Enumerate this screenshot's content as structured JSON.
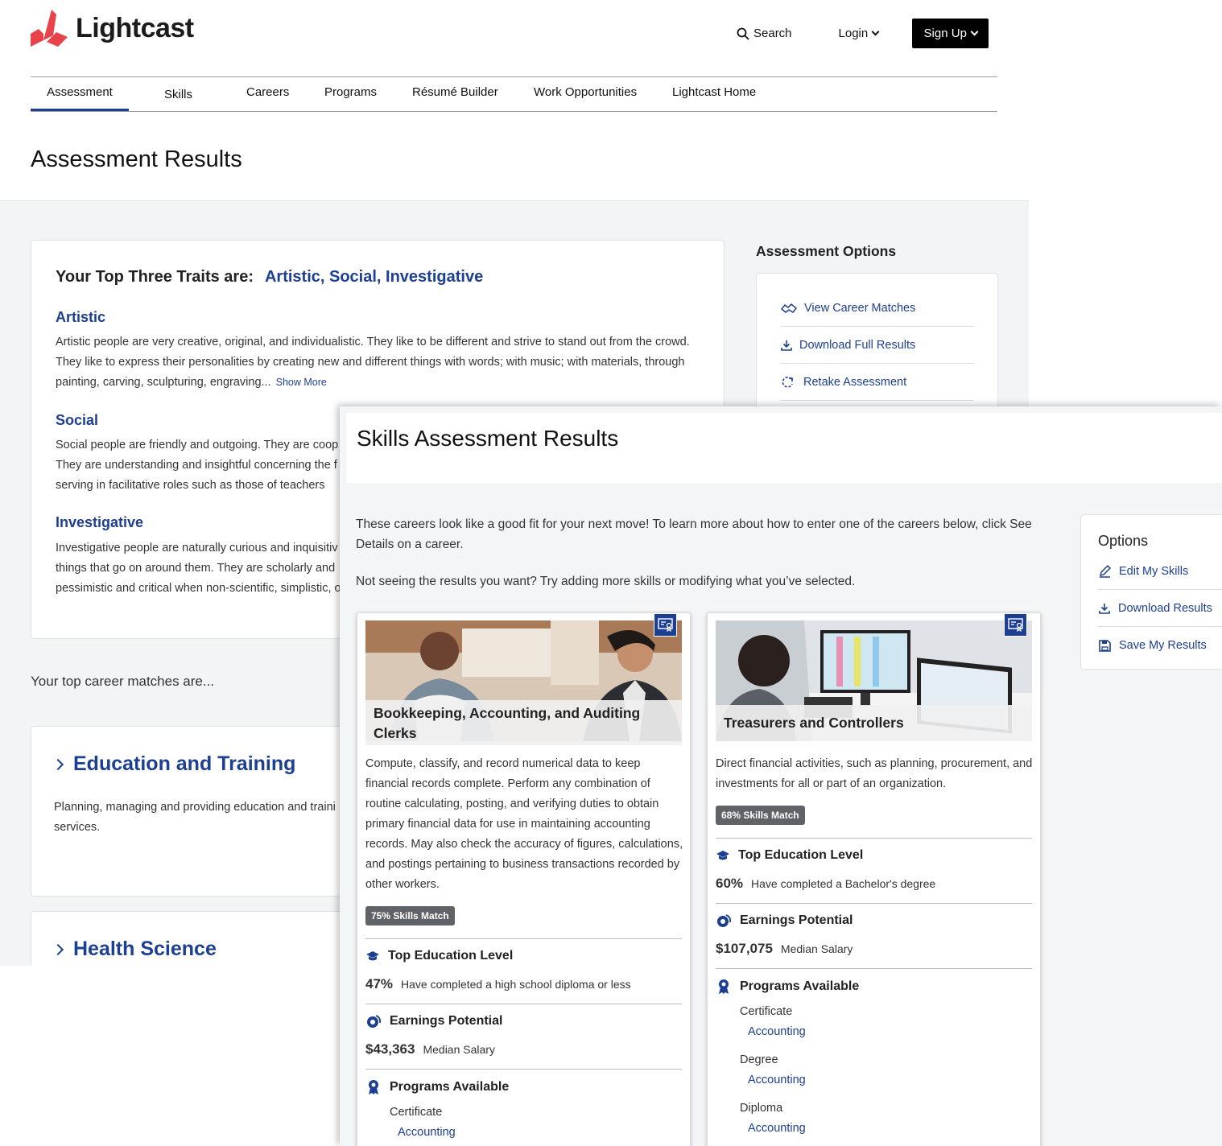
{
  "brand": {
    "name": "Lightcast",
    "color_primary": "#e8424a",
    "color_accent": "#1d3f91"
  },
  "header": {
    "search_label": "Search",
    "login_label": "Login",
    "signup_label": "Sign Up"
  },
  "nav": {
    "items": [
      {
        "label": "Assessment",
        "active": true
      },
      {
        "label": "Skills"
      },
      {
        "label": "Careers"
      },
      {
        "label": "Programs"
      },
      {
        "label": "Résumé Builder"
      },
      {
        "label": "Work Opportunities"
      },
      {
        "label": "Lightcast Home"
      }
    ]
  },
  "page_title": "Assessment Results",
  "traits": {
    "heading": "Your Top Three Traits are:",
    "summary": "Artistic, Social, Investigative",
    "show_more": "Show More",
    "items": [
      {
        "title": "Artistic",
        "desc": "Artistic people are very creative, original, and individualistic. They like to be different and strive to stand out from the crowd. They like to express their personalities by creating new and different things with words; with music; with materials, through painting, carving, sculpturing, engraving..."
      },
      {
        "title": "Social",
        "desc": "Social people are friendly and outgoing. They are coop They are understanding and insightful concerning the f by serving in facilitative roles such as those of teachers"
      },
      {
        "title": "Investigative",
        "desc": "Investigative people are naturally curious and inquisitiv things that go on around them. They are scholarly and pessimistic and critical when non-scientific, simplistic, o"
      }
    ]
  },
  "assessment_options": {
    "title": "Assessment Options",
    "items": [
      {
        "label": "View Career Matches",
        "icon": "career-matches-icon"
      },
      {
        "label": "Download Full Results",
        "icon": "download-icon"
      },
      {
        "label": "Retake Assessment",
        "icon": "retake-icon"
      }
    ]
  },
  "matches_text": "Your top career matches are...",
  "clusters": [
    {
      "title": "Education and Training",
      "desc": "Planning, managing and providing education and traini services."
    },
    {
      "title": "Health Science"
    }
  ],
  "skills_window": {
    "title": "Skills Assessment Results",
    "intro": "These careers look like a good fit for your next move! To learn more about how to enter one of the careers below, click See Details on a career.",
    "intro2": "Not seeing the results you want? Try adding more skills or modifying what you’ve selected.",
    "options": {
      "title": "Options",
      "items": [
        {
          "label": "Edit My Skills",
          "icon": "pencil-icon"
        },
        {
          "label": "Download Results",
          "icon": "download-icon"
        },
        {
          "label": "Save My Results",
          "icon": "save-icon"
        }
      ]
    },
    "careers": [
      {
        "name": "Bookkeeping, Accounting, and Auditing Clerks",
        "desc": "Compute, classify, and record numerical data to keep financial records complete. Perform any combination of routine calculating, posting, and verifying duties to obtain primary financial data for use in maintaining accounting records. May also check the accuracy of figures, calculations, and postings pertaining to business transactions recorded by other workers.",
        "match": "75% Skills Match",
        "education_title": "Top Education Level",
        "education_pct": "47%",
        "education_label": "Have completed a high school diploma or less",
        "earnings_title": "Earnings Potential",
        "earnings_value": "$43,363",
        "earnings_label": "Median Salary",
        "programs_title": "Programs Available",
        "programs": [
          {
            "type": "Certificate",
            "link": "Accounting"
          }
        ]
      },
      {
        "name": "Treasurers and Controllers",
        "desc": "Direct financial activities, such as planning, procurement, and investments for all or part of an organization.",
        "match": "68% Skills Match",
        "education_title": "Top Education Level",
        "education_pct": "60%",
        "education_label": "Have completed a Bachelor's degree",
        "earnings_title": "Earnings Potential",
        "earnings_value": "$107,075",
        "earnings_label": "Median Salary",
        "programs_title": "Programs Available",
        "programs": [
          {
            "type": "Certificate",
            "link": "Accounting"
          },
          {
            "type": "Degree",
            "link": "Accounting"
          },
          {
            "type": "Diploma",
            "link": "Accounting"
          }
        ]
      }
    ]
  }
}
